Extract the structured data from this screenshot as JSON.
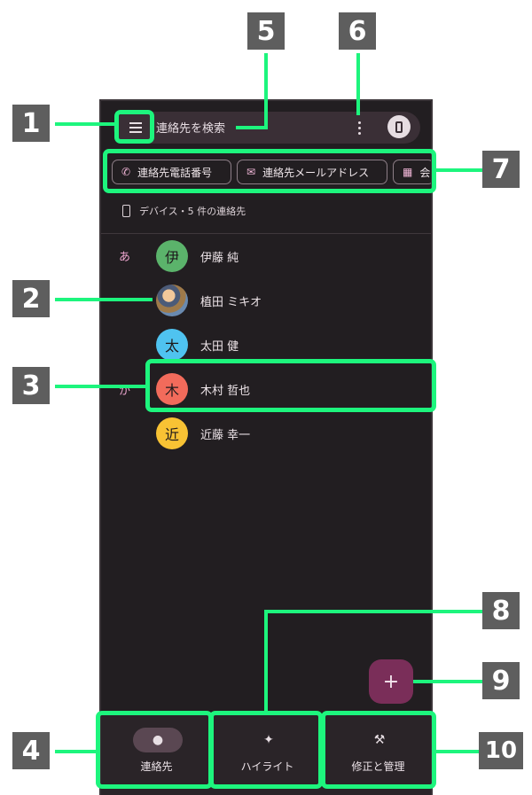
{
  "search": {
    "placeholder_text": "連絡先を検索"
  },
  "chips": [
    {
      "label": "連絡先電話番号",
      "icon": "phone-icon"
    },
    {
      "label": "連絡先メールアドレス",
      "icon": "mail-icon"
    },
    {
      "label": "会",
      "icon": "building-icon"
    }
  ],
  "account_line": "デバイス・5 件の連絡先",
  "sections": [
    {
      "letter": "あ"
    },
    {
      "letter": "か"
    }
  ],
  "contacts": [
    {
      "initial": "伊",
      "name": "伊藤 純",
      "color": "#5bb36b"
    },
    {
      "initial": "",
      "name": "植田 ミキオ",
      "photo": true
    },
    {
      "initial": "太",
      "name": "太田 健",
      "color": "#4fc3f0"
    },
    {
      "initial": "木",
      "name": "木村 哲也",
      "color": "#f26b5b"
    },
    {
      "initial": "近",
      "name": "近藤 幸一",
      "color": "#f8c234"
    }
  ],
  "fab": {
    "label": "+"
  },
  "bottom_nav": [
    {
      "label": "連絡先",
      "icon": "person-icon",
      "selected": true
    },
    {
      "label": "ハイライト",
      "icon": "highlight-icon",
      "selected": false
    },
    {
      "label": "修正と管理",
      "icon": "wrench-icon",
      "selected": false
    }
  ],
  "callouts": [
    "1",
    "2",
    "3",
    "4",
    "5",
    "6",
    "7",
    "8",
    "9",
    "10"
  ],
  "colors": {
    "callout_green": "#1df57d",
    "background": "#221e21",
    "fab": "#7a2e59"
  }
}
